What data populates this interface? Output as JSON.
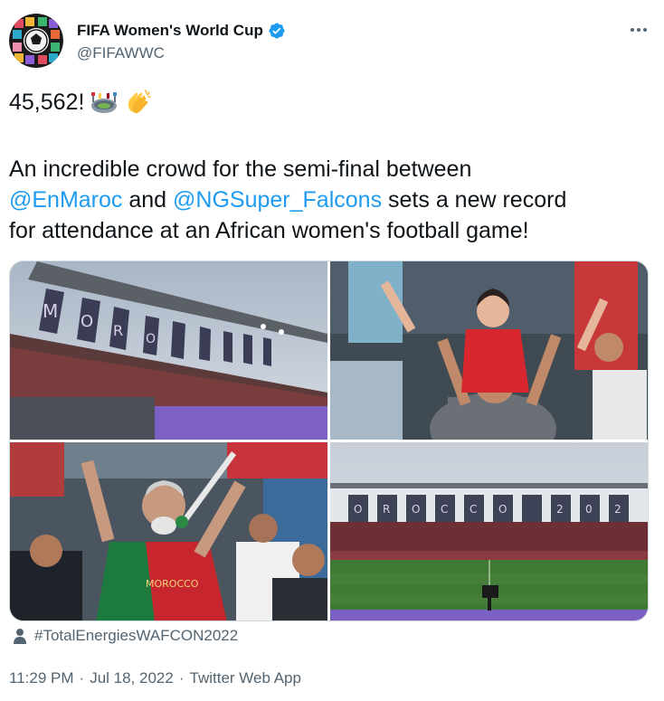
{
  "author": {
    "display_name": "FIFA Women's World Cup",
    "handle": "@FIFAWWC",
    "verified": true,
    "avatar_icon": "fifa-wwc-logo"
  },
  "tweet": {
    "count_text": "45,562!",
    "emojis": [
      "stadium-emoji",
      "clapping-hands-emoji"
    ],
    "line_prefix": "An incredible crowd for the semi-final between",
    "mention_1": "@EnMaroc",
    "connector": "and",
    "mention_2": "@NGSuper_Falcons",
    "line_suffix_1": "sets a new record",
    "line_suffix_2": "for attendance at an African women's football game!"
  },
  "media": {
    "photos": [
      {
        "name": "stadium-stands-photo"
      },
      {
        "name": "child-on-shoulders-photo"
      },
      {
        "name": "fan-with-trumpet-photo"
      },
      {
        "name": "pitch-wide-view-photo"
      }
    ],
    "banner_letters_1": [
      "M",
      "O",
      "R",
      "O"
    ],
    "banner_letters_4": [
      "O",
      "R",
      "O",
      "C",
      "C",
      "O",
      "2",
      "0",
      "2"
    ]
  },
  "tag": {
    "hashtag": "#TotalEnergiesWAFCON2022"
  },
  "meta": {
    "time": "11:29 PM",
    "separator": "·",
    "date": "Jul 18, 2022",
    "source": "Twitter Web App"
  },
  "colors": {
    "link": "#1d9bf0",
    "secondary_text": "#536471",
    "verified_badge": "#1d9bf0"
  }
}
